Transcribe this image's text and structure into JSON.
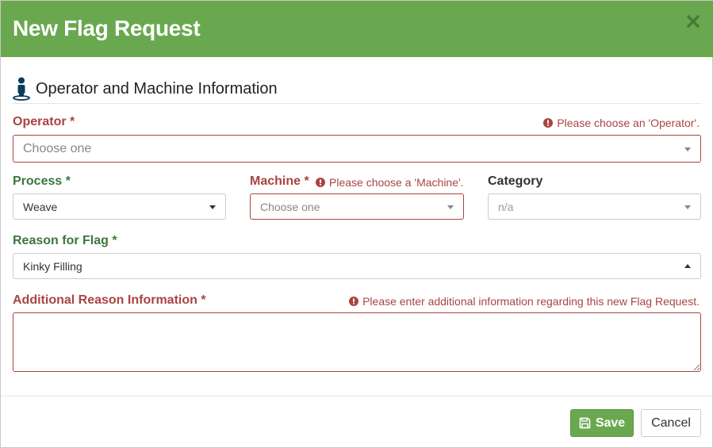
{
  "dialog": {
    "title": "New Flag Request",
    "close_icon": "close-icon"
  },
  "section": {
    "title": "Operator and Machine Information",
    "icon": "person-icon"
  },
  "operator": {
    "label": "Operator *",
    "error": "Please choose an 'Operator'.",
    "placeholder": "Choose one"
  },
  "process": {
    "label": "Process *",
    "value": "Weave"
  },
  "machine": {
    "label": "Machine *",
    "error": "Please choose a 'Machine'.",
    "placeholder": "Choose one"
  },
  "category": {
    "label": "Category",
    "value": "n/a"
  },
  "reason": {
    "label": "Reason for Flag *",
    "value": "Kinky Filling"
  },
  "additional": {
    "label": "Additional Reason Information *",
    "error": "Please enter additional information regarding this new Flag Request.",
    "value": ""
  },
  "footer": {
    "save_label": "Save",
    "save_icon": "save-icon",
    "cancel_label": "Cancel"
  },
  "colors": {
    "header": "#6aa84f",
    "error": "#a94442",
    "success": "#3c763d"
  }
}
